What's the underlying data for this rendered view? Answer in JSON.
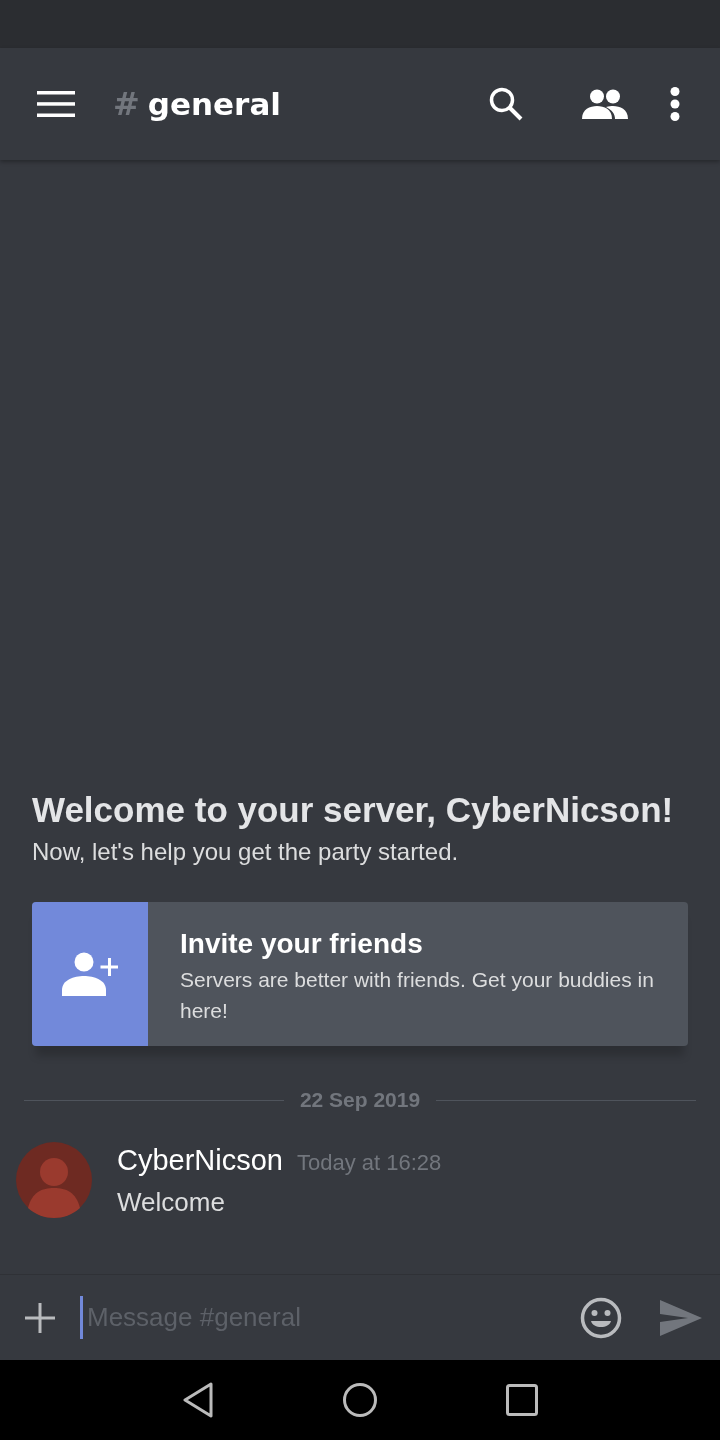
{
  "header": {
    "channel_prefix": "#",
    "channel_name": "general"
  },
  "welcome": {
    "title": "Welcome to your server, CyberNicson!",
    "subtitle": "Now, let's help you get the party started."
  },
  "invite_card": {
    "title": "Invite your friends",
    "description": "Servers are better with friends. Get your buddies in here!"
  },
  "date_divider": "22 Sep 2019",
  "messages": [
    {
      "author": "CyberNicson",
      "timestamp": "Today at 16:28",
      "text": "Welcome"
    }
  ],
  "composer": {
    "placeholder": "Message #general"
  }
}
